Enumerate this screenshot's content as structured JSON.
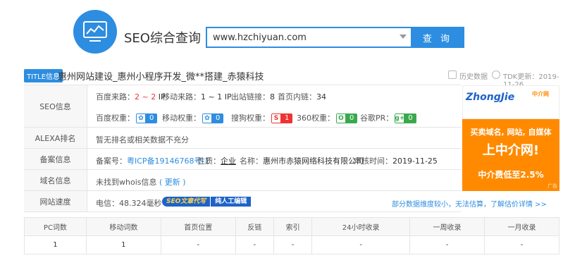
{
  "header": {
    "site_title": "SEO综合查询",
    "search_value": "www.hzchiyuan.com",
    "search_button": "查 询"
  },
  "title_row": {
    "tag": "TITLE信息",
    "title": "惠州网站建设_惠州小程序开发_微**搭建_赤猿科技",
    "history": "历史数据",
    "tdk": "TDK更新：2019-11-26"
  },
  "seo": {
    "label": "SEO信息",
    "baidu_traffic_label": "百度来路：",
    "baidu_traffic": "2 ~ 2",
    "baidu_traffic_unit": "IP",
    "mobile_traffic_label": "移动来路：",
    "mobile_traffic": "1 ~ 1 IP",
    "outlinks_label": "出站链接：",
    "outlinks": "8",
    "home_inlinks_label": "首页内链：",
    "home_inlinks": "34",
    "baidu_weight_label": "百度权重：",
    "baidu_weight": "0",
    "mobile_weight_label": "移动权重：",
    "mobile_weight": "0",
    "sogou_weight_label": "搜狗权重：",
    "sogou_weight": "1",
    "so360_weight_label": "360权重：",
    "so360_weight": "0",
    "google_pr_label": "谷歌PR：",
    "google_pr": "0"
  },
  "alexa": {
    "label": "ALEXA排名",
    "value": "暂无排名或相关数据不充分"
  },
  "icp": {
    "label": "备案信息",
    "no_label": "备案号：",
    "no": "粤ICP备19146768号-1",
    "nature_label": "性质：",
    "nature": "企业",
    "name_label": "名称：",
    "name": "惠州市赤猿网络科技有限公司",
    "date_label": "审核时间：",
    "date": "2019-11-25"
  },
  "domain": {
    "label": "域名信息",
    "value": "未找到whois信息",
    "update": "( 更新 )"
  },
  "speed": {
    "label": "网站速度",
    "value": "电信：48.324毫秒",
    "promo_left": "SEO文章代写",
    "promo_right": "纯人工编辑",
    "note": "部分数据维度较小，无法估算，了解估价详情 >>"
  },
  "ad": {
    "logo": "ZhongJie",
    "logo_sub": "中介网",
    "line1": "买卖域名, 网站, 自媒体",
    "line2": "上中介网!",
    "line3": "中介费低至2.5%",
    "tag": "广告"
  },
  "stats": {
    "headers": [
      "PC词数",
      "移动词数",
      "首页位置",
      "反链",
      "索引",
      "24小时收录",
      "一周收录",
      "一月收录"
    ],
    "row": [
      "1",
      "1",
      "-",
      "-",
      "-",
      "-",
      "-",
      "-"
    ]
  },
  "colors": {
    "accent": "#2d8de0",
    "red": "#e33",
    "green": "#3aa94d",
    "ad_orange": "#ff8a00"
  }
}
